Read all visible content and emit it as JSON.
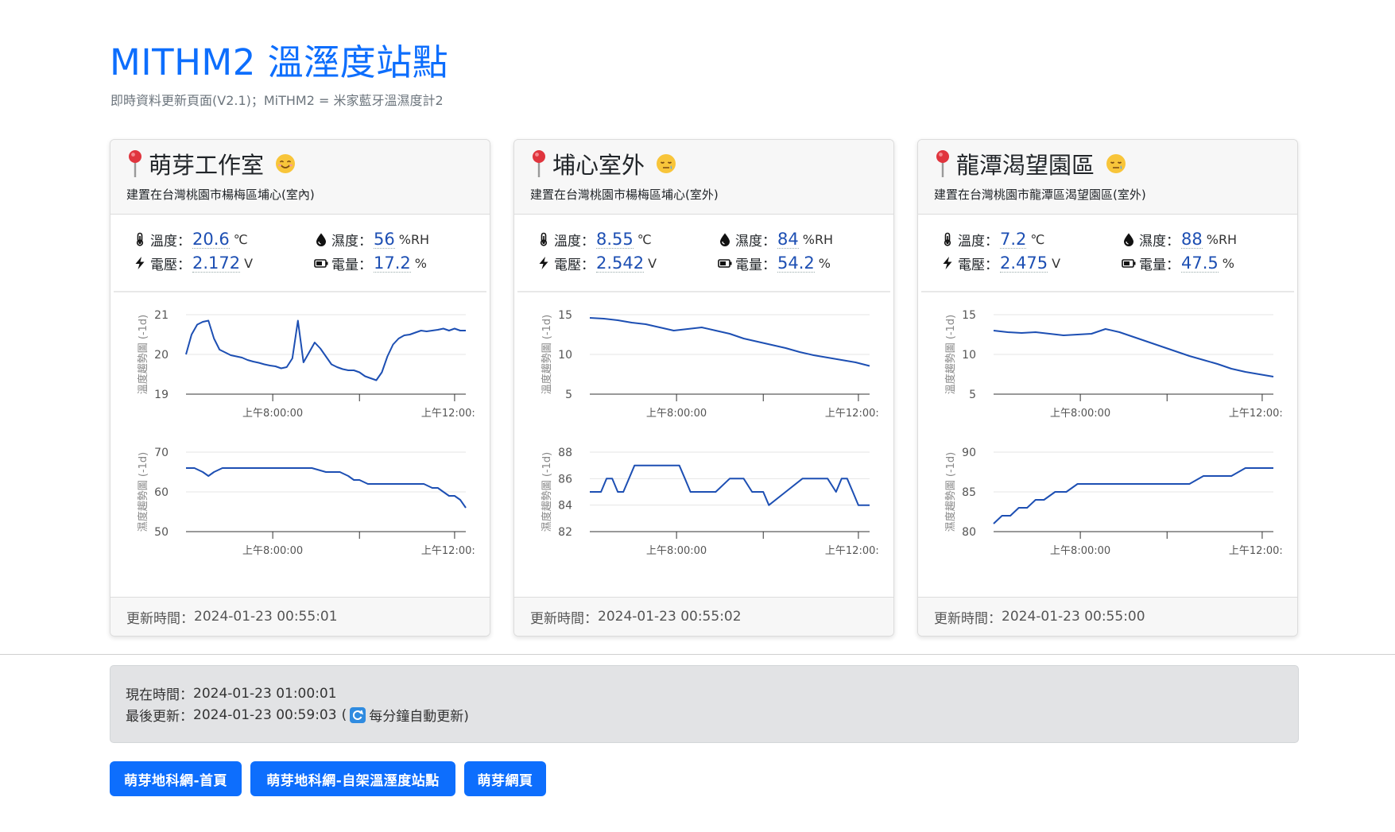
{
  "page": {
    "title": "MITHM2 溫溼度站點",
    "subtitle": "即時資料更新頁面(V2.1)；MiTHM2 = 米家藍牙溫濕度計2"
  },
  "labels": {
    "temp": "溫度：",
    "humid": "濕度：",
    "volt": "電壓：",
    "battery": "電量：",
    "temp_unit": "℃",
    "humid_unit": "%RH",
    "volt_unit": "V",
    "battery_unit": "%",
    "footer_prefix": "更新時間："
  },
  "colors": {
    "accent": "#0d6efd",
    "line": "#1d4fb3",
    "value": "#1d4fb3"
  },
  "stations": [
    {
      "name": "萌芽工作室",
      "emoji": "smiling-face",
      "location": "建置在台灣桃園市楊梅區埔心(室內)",
      "temp": "20.6",
      "humid": "56",
      "volt": "2.172",
      "battery": "17.2",
      "updated": "2024-01-23 00:55:01"
    },
    {
      "name": "埔心室外",
      "emoji": "sleepy-face",
      "location": "建置在台灣桃園市楊梅區埔心(室外)",
      "temp": "8.55",
      "humid": "84",
      "volt": "2.542",
      "battery": "54.2",
      "updated": "2024-01-23 00:55:02"
    },
    {
      "name": "龍潭渴望園區",
      "emoji": "sleepy-face",
      "location": "建置在台灣桃園市龍潭區渴望園區(室外)",
      "temp": "7.2",
      "humid": "88",
      "volt": "2.475",
      "battery": "47.5",
      "updated": "2024-01-23 00:55:00"
    }
  ],
  "chart_data": [
    {
      "type": "line",
      "station": "萌芽工作室",
      "ylabel": "溫度趨勢圖 (-1d)",
      "ylim": [
        19,
        21
      ],
      "yticks": [
        19,
        20,
        21
      ],
      "xticks": [
        "上午8:00:00",
        "上午12:00:"
      ],
      "x": [
        0,
        2,
        4,
        6,
        8,
        10,
        12,
        14,
        16,
        18,
        20,
        22,
        24,
        26,
        28,
        30,
        32,
        34,
        36,
        38,
        40,
        42,
        44,
        46,
        48,
        50,
        52,
        54,
        56,
        58,
        60,
        62,
        64,
        66,
        68,
        70,
        72,
        74,
        76,
        78,
        80,
        82,
        84,
        86,
        88,
        90,
        92,
        94,
        96,
        98,
        100
      ],
      "y": [
        20.0,
        20.5,
        20.75,
        20.82,
        20.85,
        20.4,
        20.12,
        20.05,
        19.98,
        19.95,
        19.92,
        19.86,
        19.82,
        19.79,
        19.75,
        19.72,
        19.7,
        19.65,
        19.68,
        19.9,
        20.85,
        19.8,
        20.05,
        20.3,
        20.15,
        19.95,
        19.75,
        19.68,
        19.63,
        19.6,
        19.6,
        19.55,
        19.45,
        19.4,
        19.35,
        19.55,
        19.95,
        20.25,
        20.4,
        20.48,
        20.5,
        20.55,
        20.6,
        20.58,
        20.6,
        20.62,
        20.65,
        20.6,
        20.65,
        20.6,
        20.6
      ]
    },
    {
      "type": "line",
      "station": "萌芽工作室",
      "ylabel": "濕度趨勢圖 (-1d)",
      "ylim": [
        50,
        70
      ],
      "yticks": [
        50,
        60,
        70
      ],
      "xticks": [
        "上午8:00:00",
        "上午12:00:"
      ],
      "x": [
        0,
        3,
        6,
        8,
        10,
        13,
        16,
        20,
        25,
        30,
        35,
        40,
        45,
        50,
        55,
        58,
        60,
        62,
        65,
        70,
        75,
        80,
        85,
        88,
        90,
        92,
        94,
        96,
        98,
        100
      ],
      "y": [
        66,
        66,
        65,
        64,
        65,
        66,
        66,
        66,
        66,
        66,
        66,
        66,
        66,
        65,
        65,
        64,
        63,
        63,
        62,
        62,
        62,
        62,
        62,
        61,
        61,
        60,
        59,
        59,
        58,
        56
      ]
    },
    {
      "type": "line",
      "station": "埔心室外",
      "ylabel": "溫度趨勢圖 (-1d)",
      "ylim": [
        5,
        15
      ],
      "yticks": [
        5,
        10,
        15
      ],
      "xticks": [
        "上午8:00:00",
        "上午12:00:"
      ],
      "x": [
        0,
        5,
        10,
        15,
        20,
        25,
        30,
        35,
        40,
        45,
        50,
        55,
        60,
        65,
        70,
        75,
        80,
        85,
        90,
        95,
        100
      ],
      "y": [
        14.6,
        14.5,
        14.3,
        14.0,
        13.8,
        13.4,
        13.0,
        13.2,
        13.4,
        13.0,
        12.6,
        12.0,
        11.6,
        11.2,
        10.8,
        10.3,
        9.9,
        9.6,
        9.3,
        9.0,
        8.55
      ]
    },
    {
      "type": "line",
      "station": "埔心室外",
      "ylabel": "濕度趨勢圖 (-1d)",
      "ylim": [
        82,
        88
      ],
      "yticks": [
        82,
        84,
        86,
        88
      ],
      "xticks": [
        "上午8:00:00",
        "上午12:00:"
      ],
      "x": [
        0,
        4,
        6,
        8,
        10,
        12,
        16,
        20,
        24,
        28,
        32,
        34,
        36,
        40,
        45,
        50,
        55,
        58,
        62,
        64,
        70,
        76,
        78,
        80,
        85,
        88,
        90,
        92,
        94,
        96,
        98,
        100
      ],
      "y": [
        85,
        85,
        86,
        86,
        85,
        85,
        87,
        87,
        87,
        87,
        87,
        86,
        85,
        85,
        85,
        86,
        86,
        85,
        85,
        84,
        85,
        86,
        86,
        86,
        86,
        85,
        86,
        86,
        85,
        84,
        84,
        84
      ]
    },
    {
      "type": "line",
      "station": "龍潭渴望園區",
      "ylabel": "溫度趨勢圖 (-1d)",
      "ylim": [
        5,
        15
      ],
      "yticks": [
        5,
        10,
        15
      ],
      "xticks": [
        "上午8:00:00",
        "上午12:00:"
      ],
      "x": [
        0,
        5,
        10,
        15,
        20,
        25,
        30,
        35,
        40,
        45,
        50,
        55,
        60,
        65,
        70,
        75,
        80,
        85,
        90,
        95,
        100
      ],
      "y": [
        13.0,
        12.8,
        12.7,
        12.8,
        12.6,
        12.4,
        12.5,
        12.6,
        13.2,
        12.8,
        12.2,
        11.6,
        11.0,
        10.4,
        9.8,
        9.3,
        8.8,
        8.2,
        7.8,
        7.5,
        7.2
      ]
    },
    {
      "type": "line",
      "station": "龍潭渴望園區",
      "ylabel": "濕度趨勢圖 (-1d)",
      "ylim": [
        80,
        90
      ],
      "yticks": [
        80,
        85,
        90
      ],
      "xticks": [
        "上午8:00:00",
        "上午12:00:"
      ],
      "x": [
        0,
        3,
        6,
        9,
        12,
        15,
        18,
        22,
        26,
        30,
        33,
        36,
        40,
        45,
        50,
        55,
        60,
        65,
        70,
        75,
        80,
        85,
        90,
        95,
        100
      ],
      "y": [
        81,
        82,
        82,
        83,
        83,
        84,
        84,
        85,
        85,
        86,
        86,
        86,
        86,
        86,
        86,
        86,
        86,
        86,
        86,
        87,
        87,
        87,
        88,
        88,
        88
      ]
    }
  ],
  "status": {
    "now_label": "現在時間：",
    "now": "2024-01-23 01:00:01",
    "last_label": "最後更新：",
    "last": "2024-01-23 00:59:03",
    "open_paren": "(",
    "auto_refresh": "每分鐘自動更新)"
  },
  "buttons": [
    "萌芽地科網-首頁",
    "萌芽地科網-自架溫溼度站點",
    "萌芽網頁"
  ]
}
